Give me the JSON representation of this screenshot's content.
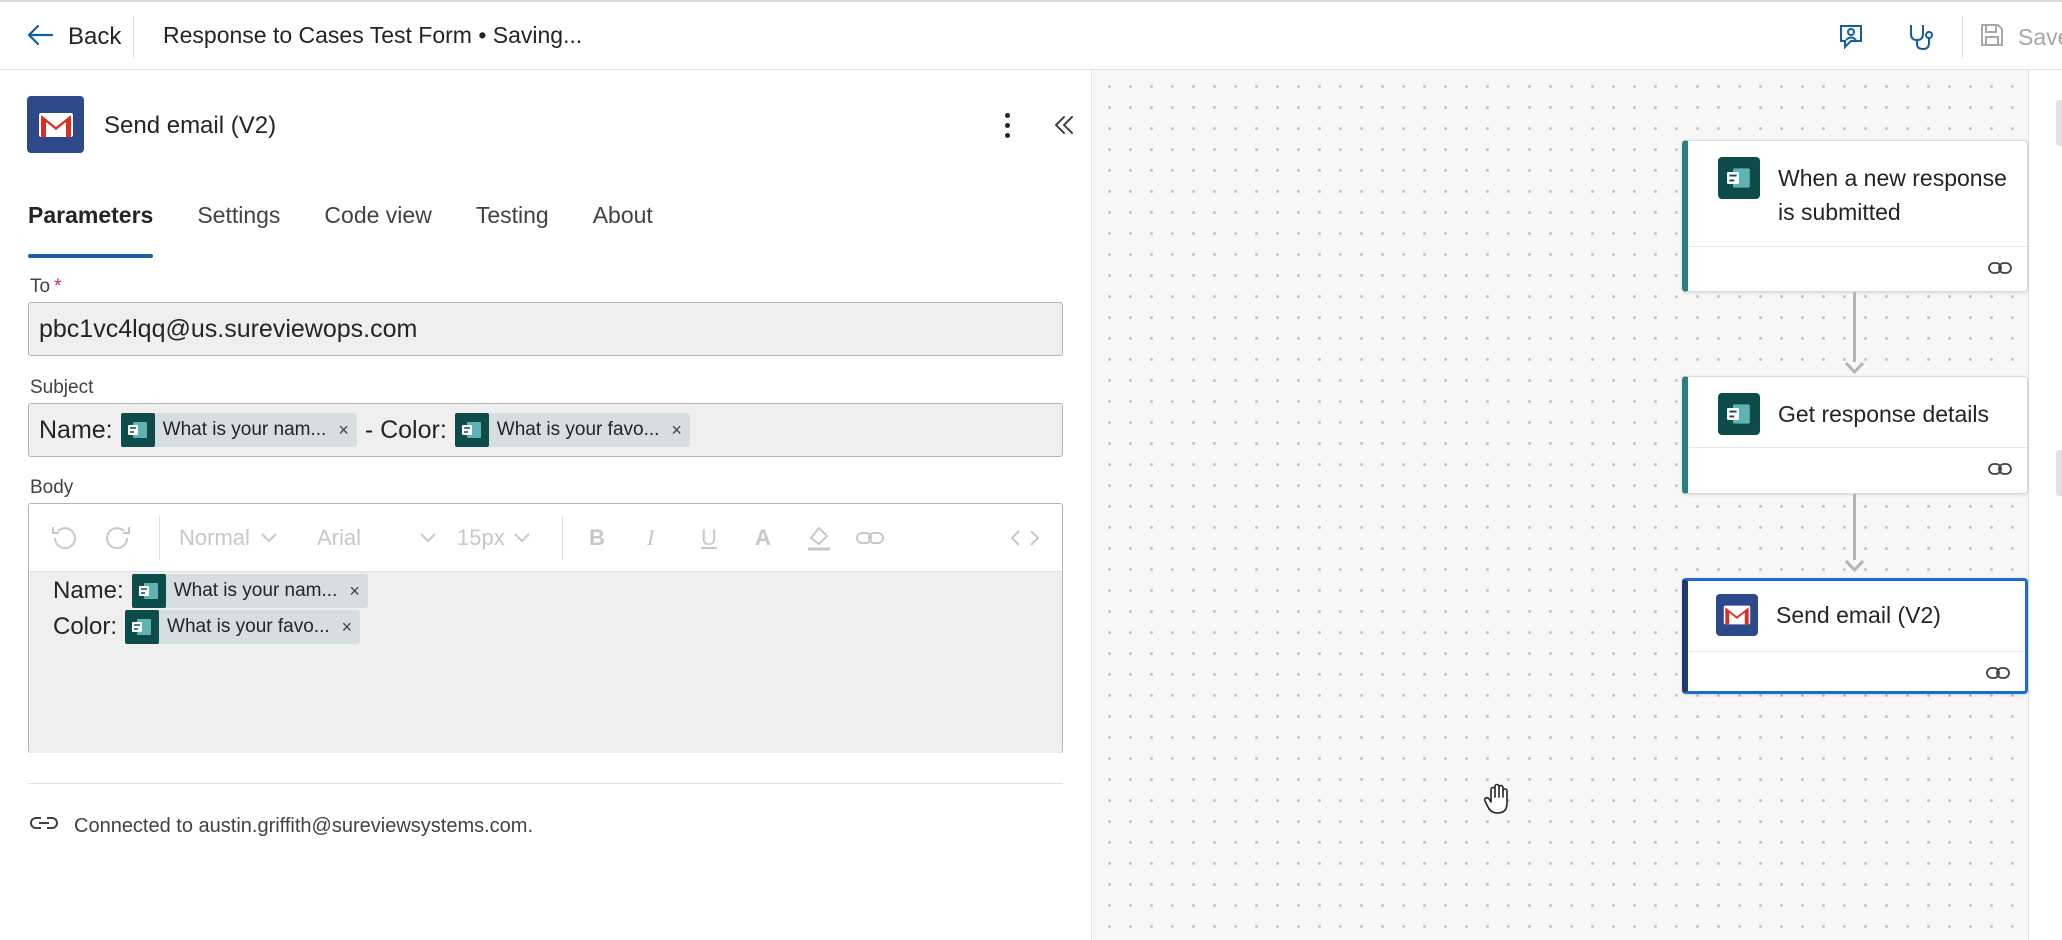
{
  "topbar": {
    "back_label": "Back",
    "flow_title": "Response to Cases Test Form • Saving...",
    "save_label": "Save",
    "icons": [
      "feedback-icon",
      "flow-checker-icon",
      "save-icon"
    ]
  },
  "panel": {
    "action_title": "Send email (V2)",
    "tabs": [
      {
        "label": "Parameters",
        "active": true
      },
      {
        "label": "Settings"
      },
      {
        "label": "Code view"
      },
      {
        "label": "Testing"
      },
      {
        "label": "About"
      }
    ],
    "to": {
      "label": "To",
      "required_mark": "*",
      "value": "pbc1vc4lqq@us.sureviewops.com"
    },
    "subject": {
      "label": "Subject",
      "prefix": "Name:",
      "token1": "What is your nam...",
      "middle": "- Color:",
      "token2": "What is your favo..."
    },
    "body": {
      "label": "Body",
      "toolbar": {
        "style": "Normal",
        "font": "Arial",
        "size": "15px"
      },
      "lines": [
        {
          "label": "Name:",
          "token": "What is your nam..."
        },
        {
          "label": "Color:",
          "token": "What is your favo..."
        }
      ]
    },
    "connection": "Connected to austin.griffith@sureviewsystems.com.",
    "token_close": "×"
  },
  "canvas": {
    "nodes": [
      {
        "title": "When a new response is submitted",
        "icon": "forms-icon"
      },
      {
        "title": "Get response details",
        "icon": "forms-icon"
      },
      {
        "title": "Send email (V2)",
        "icon": "gmail-icon",
        "selected": true
      }
    ]
  },
  "colors": {
    "accent": "#115ea3",
    "forms_teal": "#0e4c4b",
    "gmail_blue": "#2c4a8a",
    "selected_border": "#1c6bd0"
  }
}
